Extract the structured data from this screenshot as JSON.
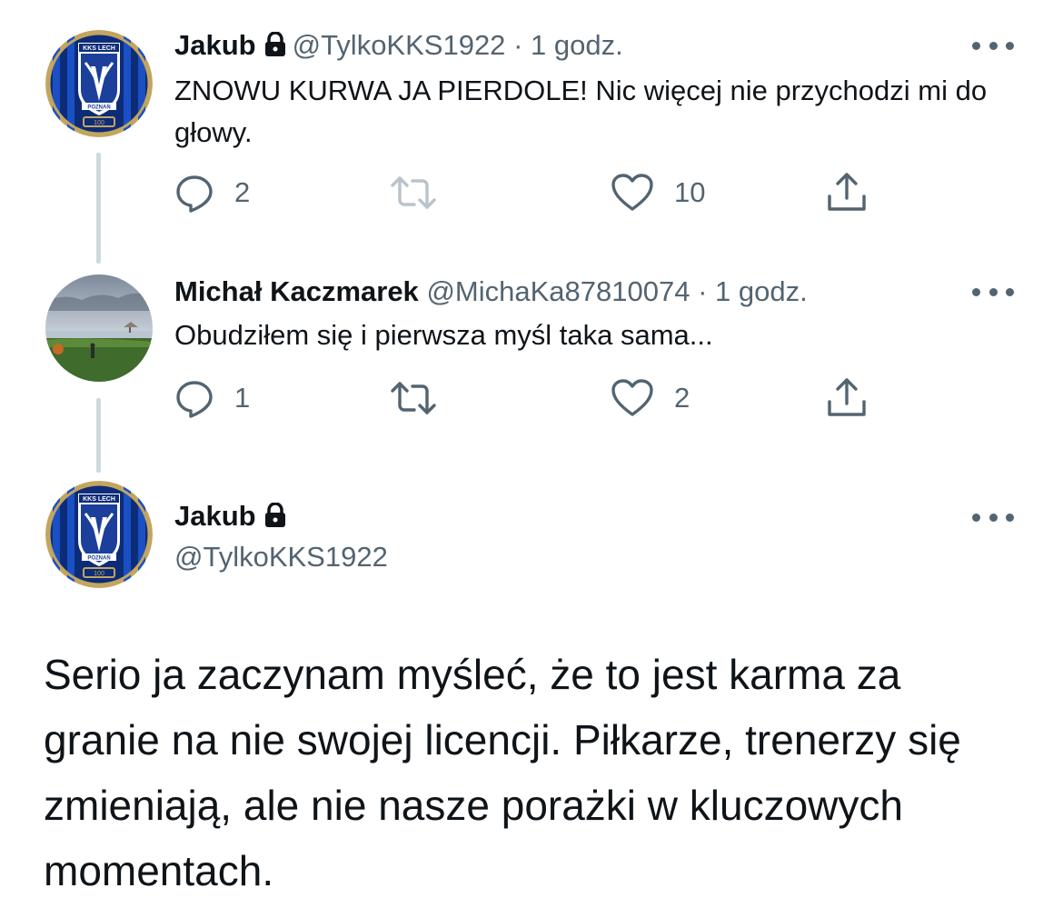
{
  "thread": [
    {
      "user": {
        "name": "Jakub",
        "handle": "@TylkoKKS1922",
        "protected": true,
        "avatar": "kks-lech-poznan-crest"
      },
      "separator": "·",
      "time": "1 godz.",
      "text": "ZNOWU KURWA JA PIERDOLE! Nic więcej nie przychodzi mi do głowy.",
      "stats": {
        "replies": "2",
        "retweets": "",
        "likes": "10"
      }
    },
    {
      "user": {
        "name": "Michał Kaczmarek",
        "handle": "@MichaKa87810074",
        "protected": false,
        "avatar": "landscape-photo"
      },
      "separator": "·",
      "time": "1 godz.",
      "text": "Obudziłem się i pierwsza myśl taka sama...",
      "stats": {
        "replies": "1",
        "retweets": "",
        "likes": "2"
      }
    }
  ],
  "main_tweet": {
    "user": {
      "name": "Jakub",
      "handle": "@TylkoKKS1922",
      "protected": true,
      "avatar": "kks-lech-poznan-crest"
    },
    "text": "Serio ja zaczynam myśleć, że to jest karma za granie na nie swojej licencji. Piłkarze, trenerzy się zmieniają, ale nie nasze porażki w kluczowych momentach."
  },
  "icons": {
    "reply": "reply-icon",
    "retweet": "retweet-icon",
    "like": "heart-icon",
    "share": "share-icon",
    "more": "more-icon",
    "lock": "lock-icon"
  },
  "colors": {
    "text": "#0f1419",
    "secondary": "#536471",
    "retweet_disabled": "#b8c3cc",
    "thread_line": "#cfd9de",
    "crest_blue": "#1b3f9a",
    "crest_border": "#b89a52"
  },
  "crest": {
    "top": "KKS LECH",
    "year": "1922",
    "city": "POZNAŃ",
    "anniversary": "100"
  }
}
